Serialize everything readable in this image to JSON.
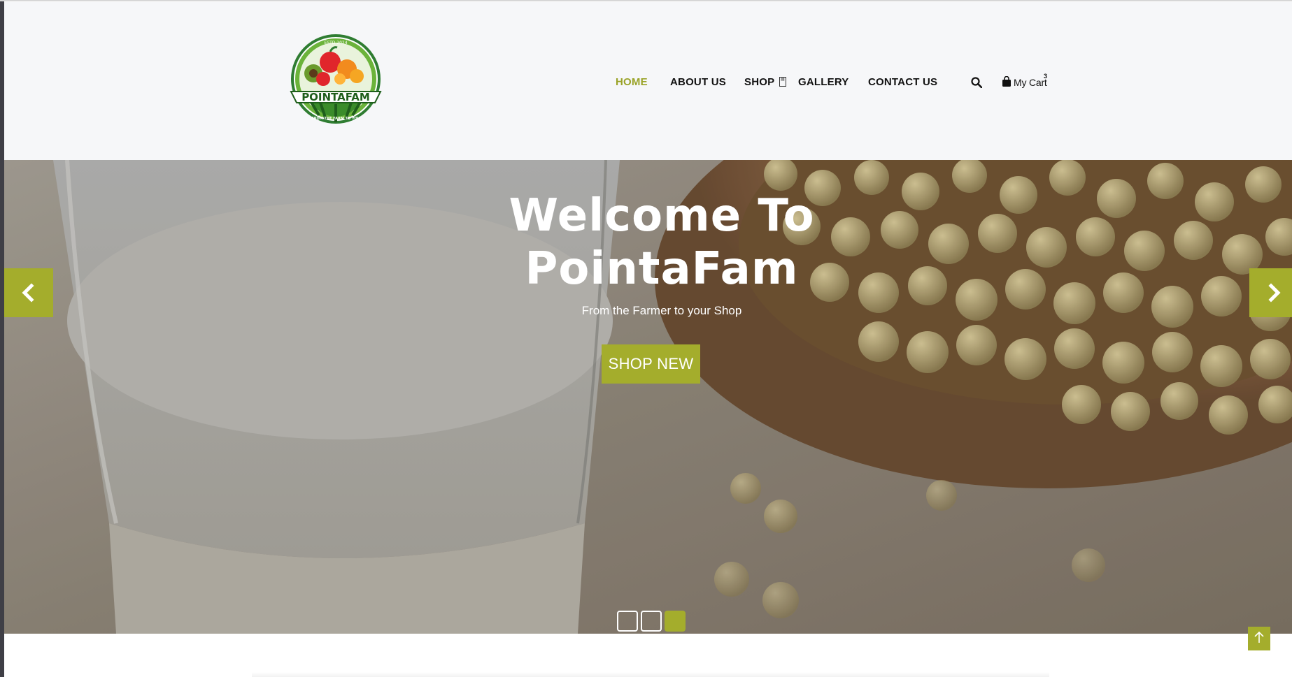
{
  "header": {
    "logo": {
      "alt": "PointaFam logo",
      "brand_text": "POINTAFAM",
      "top_text": "ESTD 2024",
      "bottom_text": "FROM THE FARM TO YOU"
    },
    "nav": [
      {
        "label": "HOME",
        "active": true
      },
      {
        "label": "ABOUT US",
        "active": false
      },
      {
        "label": "SHOP",
        "active": false
      },
      {
        "label": "GALLERY",
        "active": false
      },
      {
        "label": "CONTACT US",
        "active": false
      }
    ],
    "search_icon": "search-icon",
    "cart": {
      "label": "My Cart",
      "count": "3",
      "icon": "shopping-bag-icon"
    }
  },
  "hero": {
    "title_line1": "Welcome To",
    "title_line2": "PointaFam",
    "subtitle": "From the Farmer to your Shop",
    "button_label": "SHOP NEW",
    "slides": 3,
    "active_slide": 3,
    "prev_icon": "chevron-left-icon",
    "next_icon": "chevron-right-icon"
  },
  "scroll_top_icon": "arrow-up-icon",
  "colors": {
    "accent": "#a4ad2c",
    "active_nav": "#9aa328",
    "header_bg": "#f6f7f9",
    "text": "#111111"
  }
}
